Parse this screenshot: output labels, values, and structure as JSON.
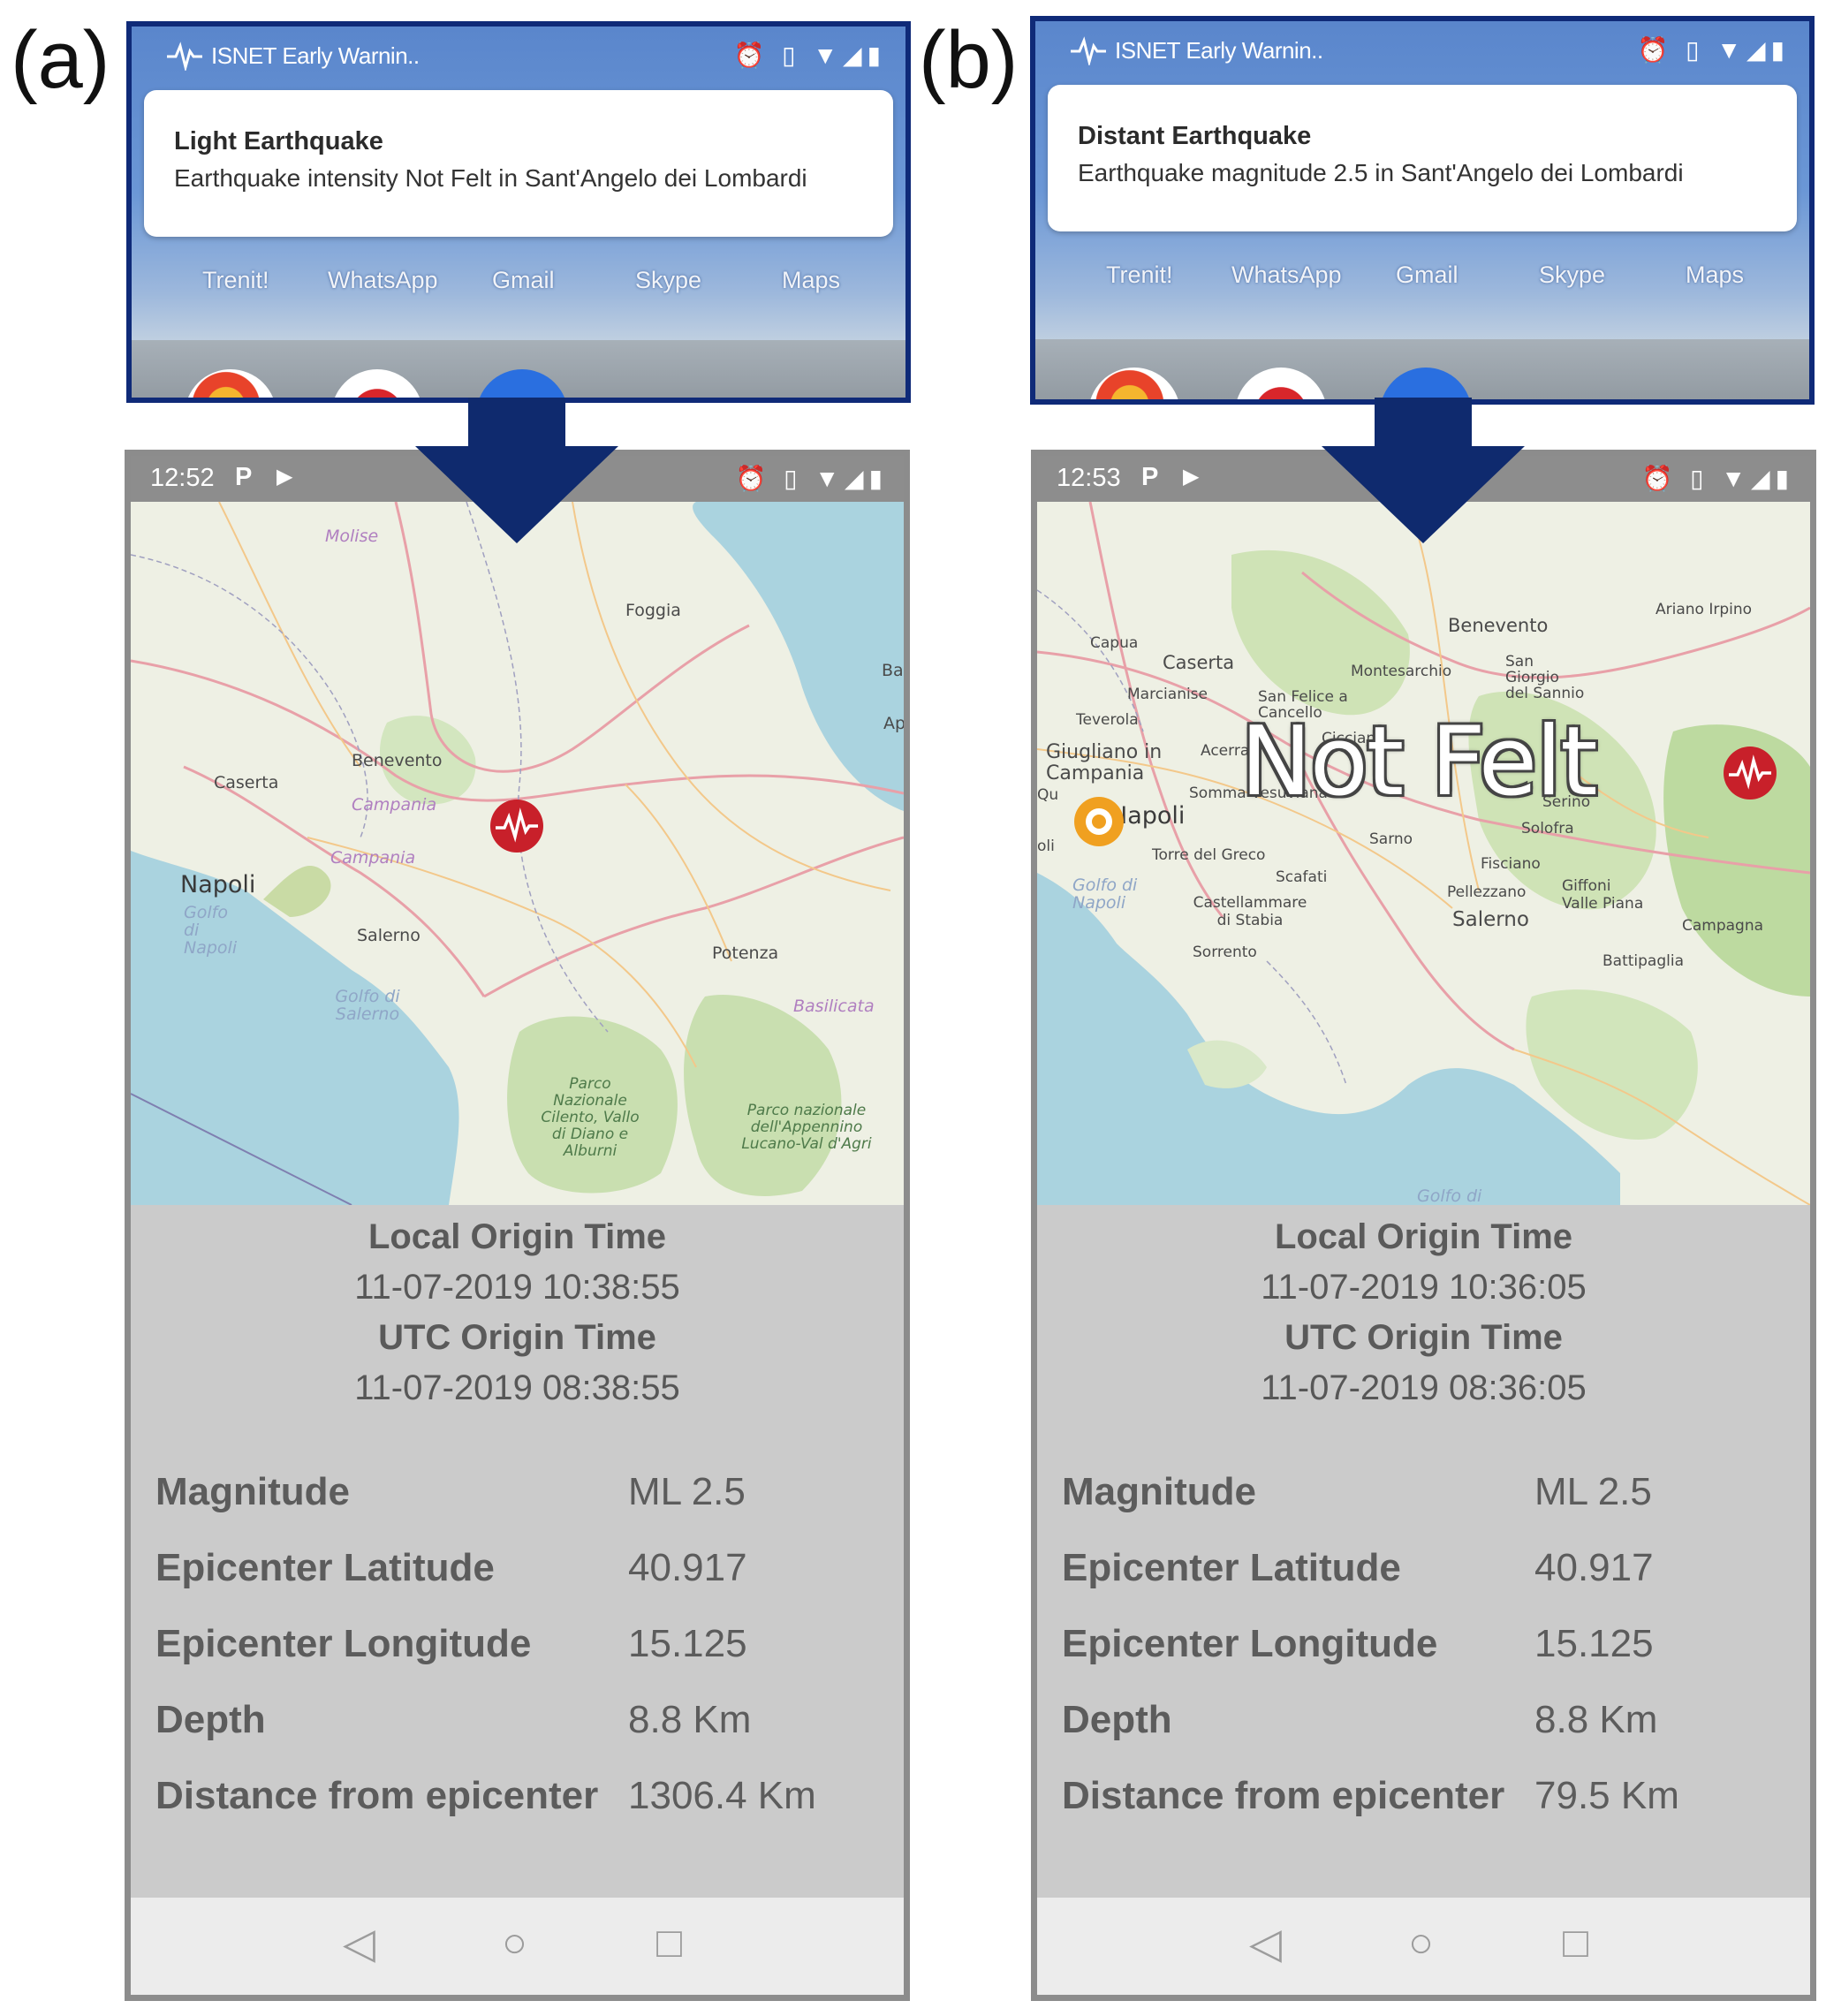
{
  "panels": [
    {
      "letter": "(a)",
      "notification": {
        "app_name": "ISNET Early Warnin..",
        "title": "Light Earthquake",
        "body": "Earthquake intensity Not Felt in Sant'Angelo dei Lombardi",
        "dock_apps": [
          "Trenit!",
          "WhatsApp",
          "Gmail",
          "Skype",
          "Maps"
        ]
      },
      "status_time": "12:52",
      "map_labels": {
        "molise": "Molise",
        "foggia": "Foggia",
        "benevento": "Benevento",
        "caserta": "Caserta",
        "campania1": "Campania",
        "campania2": "Campania",
        "napoli": "Napoli",
        "salerno": "Salerno",
        "potenza": "Potenza",
        "basilicata": "Basilicata",
        "golfo_napoli": "Golfo di Napoli",
        "golfo_salerno": "Golfo di Salerno",
        "parco1": "Parco Nazionale Cilento, Vallo di Diano e Alburni",
        "parco2": "Parco nazionale dell'Appennino Lucano-Val d'Agri",
        "ba": "Ba",
        "ap": "Ap"
      },
      "info": {
        "local_label": "Local Origin Time",
        "local_value": "11-07-2019 10:38:55",
        "utc_label": "UTC Origin Time",
        "utc_value": "11-07-2019 08:38:55",
        "rows": [
          {
            "key": "Magnitude",
            "value": "ML 2.5"
          },
          {
            "key": "Epicenter Latitude",
            "value": "40.917"
          },
          {
            "key": "Epicenter Longitude",
            "value": "15.125"
          },
          {
            "key": "Depth",
            "value": "8.8 Km"
          },
          {
            "key": "Distance from epicenter",
            "value": "1306.4 Km"
          }
        ]
      }
    },
    {
      "letter": "(b)",
      "notification": {
        "app_name": "ISNET Early Warnin..",
        "title": "Distant Earthquake",
        "body": "Earthquake magnitude 2.5 in Sant'Angelo dei Lombardi",
        "dock_apps": [
          "Trenit!",
          "WhatsApp",
          "Gmail",
          "Skype",
          "Maps"
        ]
      },
      "status_time": "12:53",
      "overlay_text": "Not Felt",
      "map_labels": {
        "benevento": "Benevento",
        "ariano": "Ariano Irpino",
        "capua": "Capua",
        "caserta": "Caserta",
        "montesarchio": "Montesarchio",
        "sangiorgio": "San Giorgio del Sannio",
        "marcianise": "Marcianise",
        "sanfelice": "San Felice a Cancello",
        "teverola": "Teverola",
        "giugliano": "Giugliano in Campania",
        "acerra": "Acerra",
        "cicciano": "Cicciano",
        "somma": "Somma Vesuviana",
        "napoli": "Napoli",
        "serino": "Serino",
        "solofra": "Solofra",
        "sarno": "Sarno",
        "torre": "Torre del Greco",
        "scafati": "Scafati",
        "fisciano": "Fisciano",
        "golfo_napoli": "Golfo di Napoli",
        "pellezzano": "Pellezzano",
        "giffoni": "Giffoni Valle Piana",
        "castellammare": "Castellammare di Stabia",
        "salerno": "Salerno",
        "campagna": "Campagna",
        "sorrento": "Sorrento",
        "battipaglia": "Battipaglia",
        "golfo_salerno": "Golfo di",
        "qu": "Qu",
        "oli": "oli"
      },
      "info": {
        "local_label": "Local Origin Time",
        "local_value": "11-07-2019 10:36:05",
        "utc_label": "UTC Origin Time",
        "utc_value": "11-07-2019 08:36:05",
        "rows": [
          {
            "key": "Magnitude",
            "value": "ML 2.5"
          },
          {
            "key": "Epicenter Latitude",
            "value": "40.917"
          },
          {
            "key": "Epicenter Longitude",
            "value": "15.125"
          },
          {
            "key": "Depth",
            "value": "8.8 Km"
          },
          {
            "key": "Distance from epicenter",
            "value": "79.5 Km"
          }
        ]
      }
    }
  ],
  "colors": {
    "frame_blue": "#0f2a78",
    "arrow_navy": "#0f2a6e",
    "phone_frame": "#8c8c8c",
    "quake_marker": "#c8202a",
    "user_marker": "#f0a020"
  },
  "icons": {
    "quake_marker": "seismic-pulse-icon",
    "user_marker": "location-ring-icon",
    "back": "back-triangle-icon",
    "home": "home-circle-icon",
    "recents": "recents-square-icon"
  }
}
